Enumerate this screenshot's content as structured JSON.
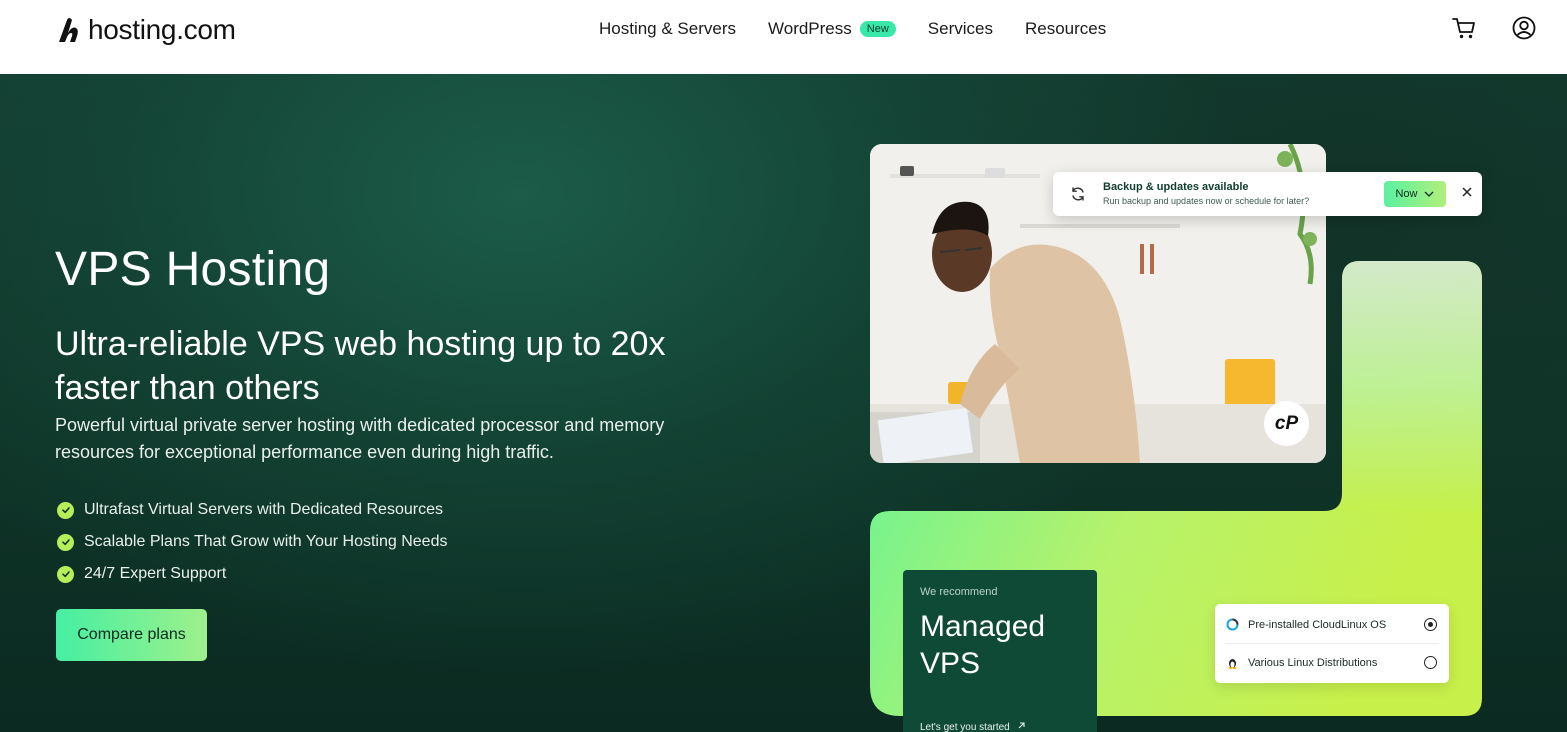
{
  "header": {
    "logo_text": "hosting.com",
    "nav": [
      {
        "label": "Hosting & Servers"
      },
      {
        "label": "WordPress",
        "badge": "New"
      },
      {
        "label": "Services"
      },
      {
        "label": "Resources"
      }
    ],
    "icons": [
      "cart-icon",
      "account-icon"
    ]
  },
  "hero": {
    "title": "VPS Hosting",
    "subtitle": "Ultra-reliable VPS web hosting up to 20x faster than others",
    "description": "Powerful virtual private server hosting with dedicated processor and memory resources for exceptional performance even during high traffic.",
    "features": [
      "Ultrafast Virtual Servers with Dedicated Resources",
      "Scalable Plans That Grow with Your Hosting Needs",
      "24/7 Expert Support"
    ],
    "cta_label": "Compare plans"
  },
  "notification": {
    "title": "Backup & updates available",
    "body": "Run backup and updates now or schedule for later?",
    "button_label": "Now"
  },
  "cpanel_badge": "cP",
  "recommend_card": {
    "label": "We recommend",
    "title": "Managed VPS",
    "link_label": "Let's get you started"
  },
  "os_options": [
    {
      "label": "Pre-installed CloudLinux OS",
      "selected": true
    },
    {
      "label": "Various Linux Distributions",
      "selected": false
    }
  ],
  "colors": {
    "accent_green": "#38e8a8",
    "lime": "#b6ef5a",
    "hero_dark": "#0f3428",
    "card_green": "#0f4a37"
  }
}
